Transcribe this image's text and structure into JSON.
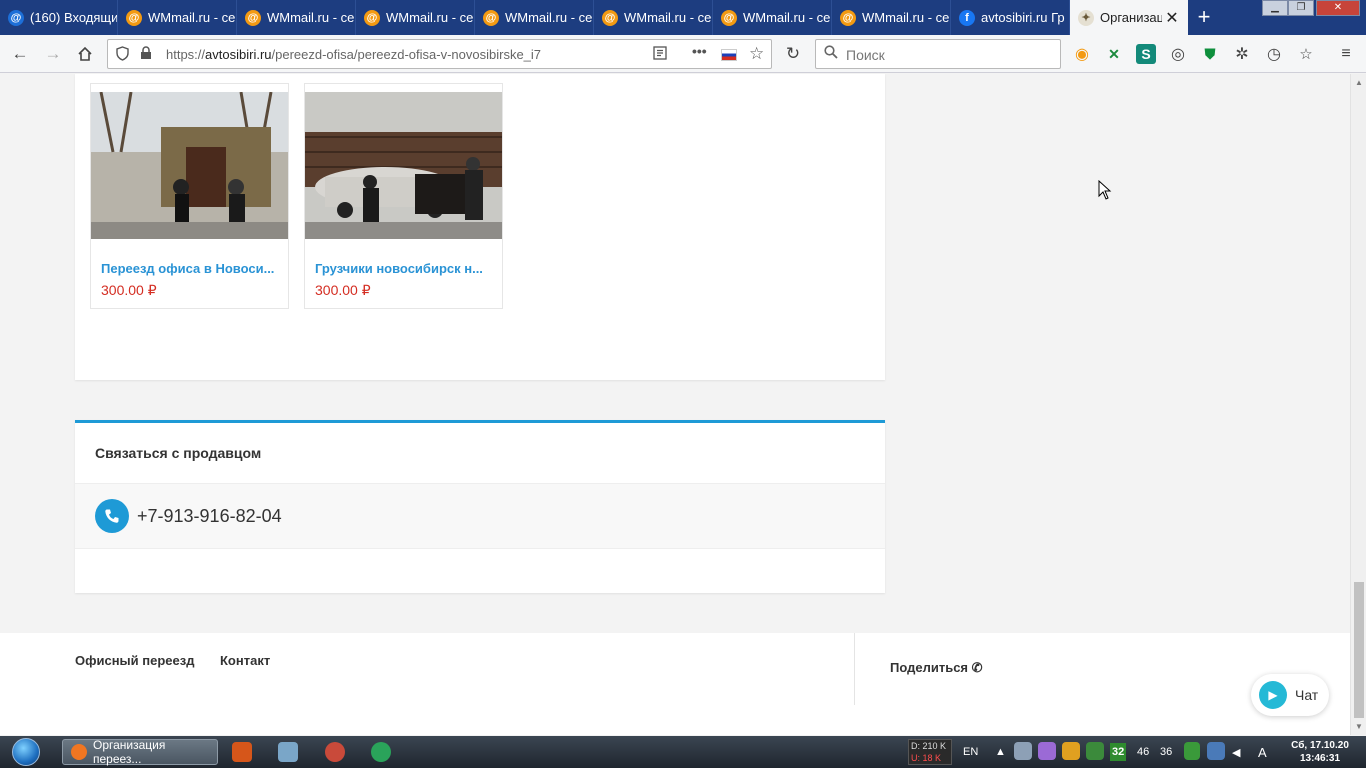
{
  "browser": {
    "tabs": [
      {
        "title": "(160) Входящи",
        "favicon": "mail-icon",
        "active": false
      },
      {
        "title": "WMmail.ru - се",
        "favicon": "wmmail-icon",
        "active": false
      },
      {
        "title": "WMmail.ru - се",
        "favicon": "wmmail-icon",
        "active": false
      },
      {
        "title": "WMmail.ru - се",
        "favicon": "wmmail-icon",
        "active": false
      },
      {
        "title": "WMmail.ru - се",
        "favicon": "wmmail-icon",
        "active": false
      },
      {
        "title": "WMmail.ru - се",
        "favicon": "wmmail-icon",
        "active": false
      },
      {
        "title": "WMmail.ru - се",
        "favicon": "wmmail-icon",
        "active": false
      },
      {
        "title": "WMmail.ru - се",
        "favicon": "wmmail-icon",
        "active": false
      },
      {
        "title": "avtosibiri.ru Гр",
        "favicon": "facebook-icon",
        "active": false
      },
      {
        "title": "Организац",
        "favicon": "organization-icon",
        "active": true
      }
    ],
    "url_prefix": "https://",
    "url_host": "avtosibiri.ru",
    "url_path": "/pereezd-ofisa/pereezd-ofisa-v-novosibirske_i7",
    "search_placeholder": "Поиск"
  },
  "products": [
    {
      "name": "Переезд офиса в Новоси...",
      "price": "300.00 ₽"
    },
    {
      "name": "Грузчики новосибирск н...",
      "price": "300.00 ₽"
    }
  ],
  "contact": {
    "heading": "Связаться с продавцом",
    "phone": "+7-913-916-82-04"
  },
  "footer": {
    "links": [
      "Офисный переезд",
      "Контакт"
    ],
    "share": "Поделиться"
  },
  "chat": {
    "label": "Чат"
  },
  "taskbar": {
    "active_task": "Организация переез...",
    "net_down": "D: 210 K",
    "net_up": "U: 18 K",
    "lang": "EN",
    "tray_num1": "32",
    "tray_num2": "46",
    "tray_num3": "36",
    "clock_date": "Сб, 17.10.20",
    "clock_time": "13:46:31"
  },
  "colors": {
    "accent_blue": "#1e9ad6",
    "price_red": "#d42d22",
    "link_blue": "#2a93d5",
    "tabbar": "#1d3d80"
  }
}
